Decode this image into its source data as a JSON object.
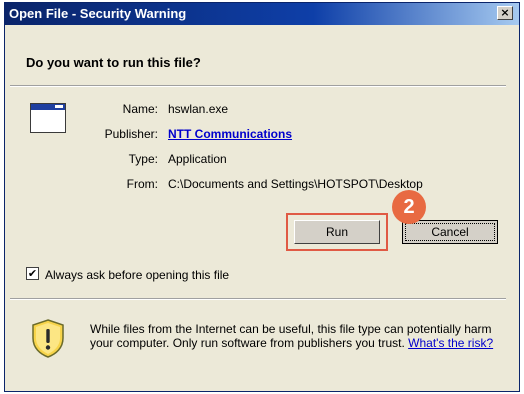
{
  "window": {
    "title": "Open File - Security Warning",
    "close_label": "×"
  },
  "question": "Do you want to run this file?",
  "details": {
    "name_label": "Name:",
    "name_value": "hswlan.exe",
    "publisher_label": "Publisher:",
    "publisher_value": "NTT Communications",
    "type_label": "Type:",
    "type_value": "Application",
    "from_label": "From:",
    "from_value": "C:\\Documents and Settings\\HOTSPOT\\Desktop"
  },
  "buttons": {
    "run": "Run",
    "cancel": "Cancel"
  },
  "step_badge": "2",
  "checkbox": {
    "label": "Always ask before opening this file",
    "checked_mark": "✔"
  },
  "warning": {
    "text": "While files from the Internet can be useful, this file type can potentially harm your computer. Only run software from publishers you trust.",
    "link": "What's the risk?"
  },
  "colors": {
    "titlebar": "#0A246A",
    "dialog_bg": "#ECE9D8",
    "highlight": "#E05A44",
    "badge": "#E86A42",
    "link": "#0000CC"
  }
}
